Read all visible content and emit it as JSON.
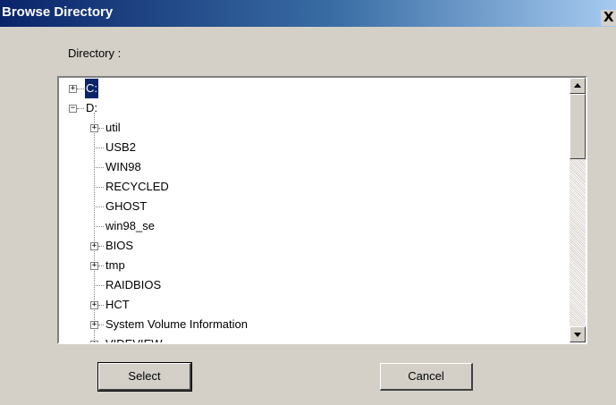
{
  "window": {
    "title": "Browse Directory",
    "close_glyph": "X"
  },
  "directory_label": "Directory :",
  "tree": [
    {
      "label": "C:",
      "indent": 0,
      "expander": "+",
      "selected": true
    },
    {
      "label": "D:",
      "indent": 0,
      "expander": "-"
    },
    {
      "label": "util",
      "indent": 1,
      "expander": "+"
    },
    {
      "label": "USB2",
      "indent": 1,
      "expander": null
    },
    {
      "label": "WIN98",
      "indent": 1,
      "expander": null
    },
    {
      "label": "RECYCLED",
      "indent": 1,
      "expander": null
    },
    {
      "label": "GHOST",
      "indent": 1,
      "expander": null
    },
    {
      "label": "win98_se",
      "indent": 1,
      "expander": null
    },
    {
      "label": "BIOS",
      "indent": 1,
      "expander": "+"
    },
    {
      "label": "tmp",
      "indent": 1,
      "expander": "+"
    },
    {
      "label": "RAIDBIOS",
      "indent": 1,
      "expander": null
    },
    {
      "label": "HCT",
      "indent": 1,
      "expander": "+"
    },
    {
      "label": "System Volume Information",
      "indent": 1,
      "expander": "+"
    },
    {
      "label": "VIDEVIEW",
      "indent": 1,
      "expander": "+"
    }
  ],
  "buttons": {
    "select": "Select",
    "cancel": "Cancel"
  },
  "icons": {
    "expand": "plus-box-icon",
    "collapse": "minus-box-icon",
    "scroll_up": "arrow-up-icon",
    "scroll_down": "arrow-down-icon"
  }
}
